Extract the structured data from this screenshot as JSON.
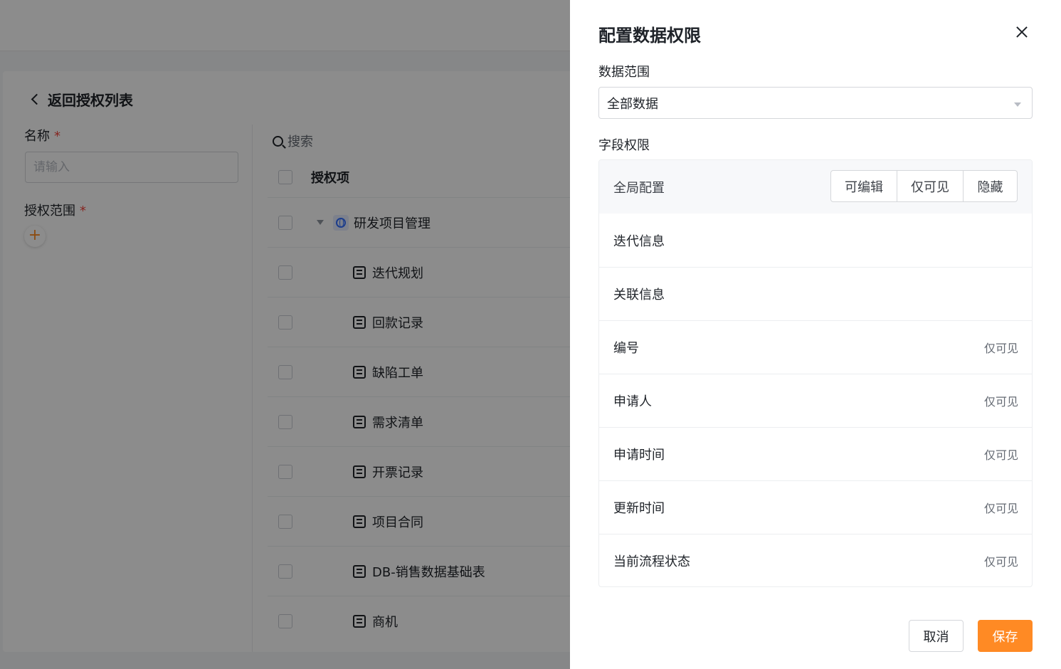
{
  "page": {
    "back_label": "返回授权列表",
    "name_label": "名称",
    "name_placeholder": "请输入",
    "scope_label": "授权范围",
    "required_mark": "*",
    "add_icon": "+",
    "search_label": "搜索",
    "table_header": "授权项",
    "tree": {
      "root": "研发项目管理",
      "items": [
        "迭代规划",
        "回款记录",
        "缺陷工单",
        "需求清单",
        "开票记录",
        "项目合同",
        "DB-销售数据基础表",
        "商机"
      ]
    }
  },
  "drawer": {
    "title": "配置数据权限",
    "data_scope_label": "数据范围",
    "data_scope_value": "全部数据",
    "field_perm_label": "字段权限",
    "global": {
      "label": "全局配置",
      "options": [
        "可编辑",
        "仅可见",
        "隐藏"
      ]
    },
    "fields": [
      {
        "name": "迭代信息",
        "value": ""
      },
      {
        "name": "关联信息",
        "value": ""
      },
      {
        "name": "编号",
        "value": "仅可见"
      },
      {
        "name": "申请人",
        "value": "仅可见"
      },
      {
        "name": "申请时间",
        "value": "仅可见"
      },
      {
        "name": "更新时间",
        "value": "仅可见"
      },
      {
        "name": "当前流程状态",
        "value": "仅可见"
      }
    ],
    "cancel_label": "取消",
    "save_label": "保存"
  },
  "colors": {
    "accent": "#ff8a24",
    "required": "#f5453d",
    "overlay": "rgba(0,0,0,0.45)"
  }
}
